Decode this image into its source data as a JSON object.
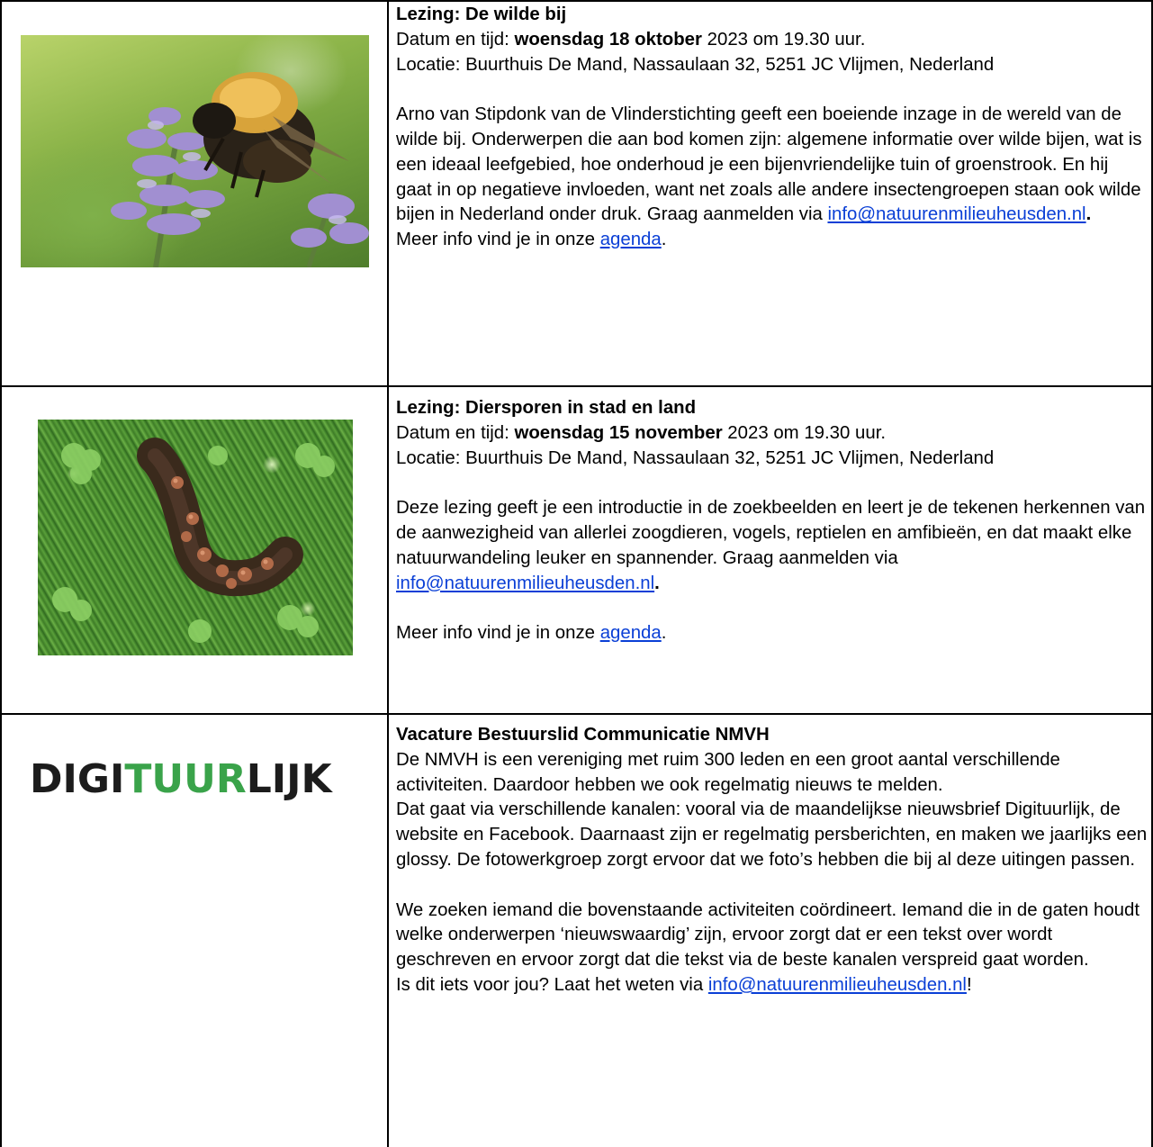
{
  "row1": {
    "title": "Lezing: De wilde bij",
    "date_prefix": "Datum en tijd: ",
    "date_bold": "woensdag 18 oktober",
    "date_suffix": " 2023 om 19.30 uur.",
    "location": "Locatie: Buurthuis De Mand, Nassaulaan 32, 5251 JC Vlijmen, Nederland",
    "body": "Arno van Stipdonk van de Vlinderstichting geeft een boeiende inzage in de wereld van de wilde bij. Onderwerpen die aan bod komen zijn: algemene informatie over wilde bijen, wat is een ideaal leefgebied, hoe onderhoud je een bijenvriendelijke tuin of groenstrook. En hij gaat in op negatieve invloeden, want net zoals alle andere insectengroepen staan ook wilde bijen in Nederland onder druk. Graag aanmelden via ",
    "email": "info@natuurenmilieuheusden.nl",
    "email_after": ".",
    "more_prefix": "Meer info vind je in onze ",
    "more_link": "agenda",
    "more_suffix": "."
  },
  "row2": {
    "title": "Lezing: Diersporen in stad en land",
    "date_prefix": "Datum en tijd: ",
    "date_bold": "woensdag 15 november",
    "date_suffix": " 2023 om 19.30 uur.",
    "location": "Locatie: Buurthuis De Mand, Nassaulaan 32, 5251 JC Vlijmen, Nederland",
    "body": "Deze lezing geeft je een introductie in de zoekbeelden en leert je de tekenen herkennen van de aanwezigheid van allerlei zoogdieren, vogels, reptielen en amfibieën, en dat maakt elke natuurwandeling leuker en spannender. Graag aanmelden via ",
    "email": "info@natuurenmilieuheusden.nl",
    "email_after": ".",
    "more_prefix": "Meer info vind je in onze ",
    "more_link": "agenda",
    "more_suffix": "."
  },
  "row3": {
    "logo_dark1": "DIGI",
    "logo_green": "TUUR",
    "logo_dark2": "LIJK",
    "title": "Vacature Bestuurslid Communicatie NMVH",
    "para1": "De NMVH is een vereniging met ruim 300 leden en een groot aantal verschillende activiteiten. Daardoor hebben we ook regelmatig nieuws te melden.",
    "para2": "Dat gaat via verschillende kanalen: vooral via de maandelijkse nieuwsbrief Digituurlijk, de website en Facebook. Daarnaast zijn er regelmatig persberichten, en maken we jaarlijks een glossy. De fotowerkgroep zorgt ervoor dat we foto’s hebben die bij al deze uitingen passen.",
    "para3": "We zoeken iemand die bovenstaande activiteiten coördineert. Iemand die in de gaten houdt welke onderwerpen ‘nieuwswaardig’ zijn, ervoor zorgt dat er een tekst over wordt geschreven en ervoor zorgt dat die tekst via de beste kanalen verspreid gaat worden.",
    "cta_prefix": "Is dit iets voor jou? Laat het weten via ",
    "email": "info@natuurenmilieuheusden.nl",
    "cta_suffix": "!"
  },
  "colors": {
    "link": "#0a3fd6",
    "logo_green": "#3aa34a",
    "border": "#000000"
  }
}
